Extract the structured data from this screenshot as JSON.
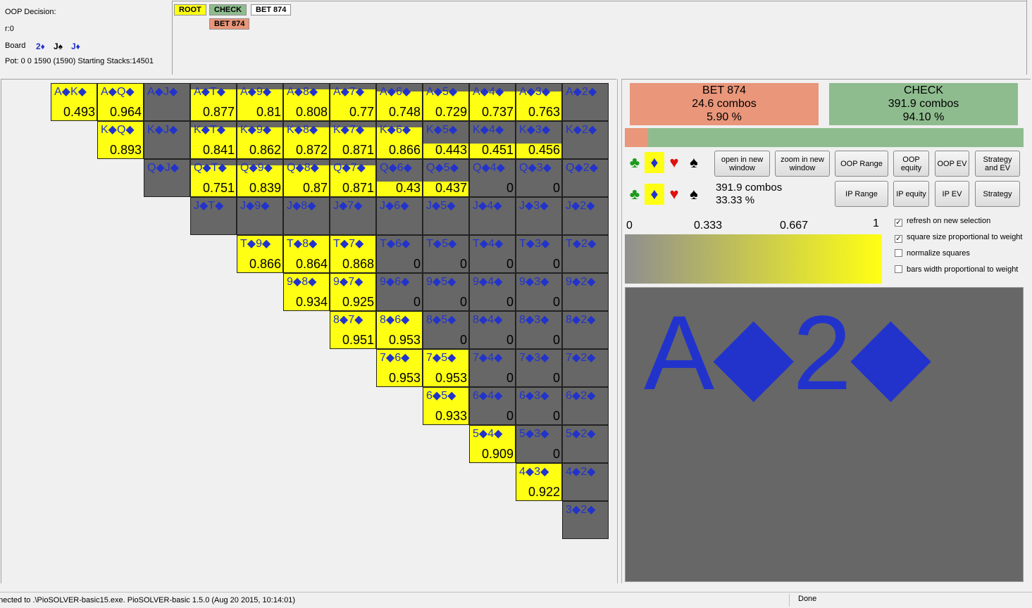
{
  "info": {
    "decision": "OOP Decision:",
    "r": "r:0",
    "board_label": "Board",
    "board_cards": [
      "2♦",
      "J♠",
      "J♦"
    ],
    "pot": "Pot: 0 0 1590 (1590) Starting Stacks:14501"
  },
  "tree": {
    "root": "ROOT",
    "check": "CHECK",
    "bet": "BET 874",
    "bet_child": "BET 874",
    "colors": {
      "root": "#ffff14",
      "check": "#8fbc8f",
      "bet_selected": "#ffffff",
      "bet": "#e9967a"
    }
  },
  "grid": {
    "rows": [
      {
        "row": 0,
        "cells": [
          {
            "label": "A◆K◆",
            "value": "0.493",
            "fill": 1
          },
          {
            "label": "A◆Q◆",
            "value": "0.964",
            "fill": 1
          },
          {
            "label": "A◆J◆",
            "value": "",
            "fill": 0
          },
          {
            "label": "A◆T◆",
            "value": "0.877",
            "fill": 0.85
          },
          {
            "label": "A◆9◆",
            "value": "0.81",
            "fill": 0.85
          },
          {
            "label": "A◆8◆",
            "value": "0.808",
            "fill": 0.85
          },
          {
            "label": "A◆7◆",
            "value": "0.77",
            "fill": 0.85
          },
          {
            "label": "A◆6◆",
            "value": "0.748",
            "fill": 0.78
          },
          {
            "label": "A◆5◆",
            "value": "0.729",
            "fill": 0.78
          },
          {
            "label": "A◆4◆",
            "value": "0.737",
            "fill": 0.78
          },
          {
            "label": "A◆3◆",
            "value": "0.763",
            "fill": 0.78
          },
          {
            "label": "A◆2◆",
            "value": "",
            "fill": 0
          }
        ]
      },
      {
        "row": 1,
        "cells": [
          {
            "label": "K◆Q◆",
            "value": "0.893",
            "fill": 1
          },
          {
            "label": "K◆J◆",
            "value": "",
            "fill": 0
          },
          {
            "label": "K◆T◆",
            "value": "0.841",
            "fill": 0.85
          },
          {
            "label": "K◆9◆",
            "value": "0.862",
            "fill": 0.85
          },
          {
            "label": "K◆8◆",
            "value": "0.872",
            "fill": 0.85
          },
          {
            "label": "K◆7◆",
            "value": "0.871",
            "fill": 0.85
          },
          {
            "label": "K◆6◆",
            "value": "0.866",
            "fill": 0.85
          },
          {
            "label": "K◆5◆",
            "value": "0.443",
            "fill": 0.4
          },
          {
            "label": "K◆4◆",
            "value": "0.451",
            "fill": 0.4
          },
          {
            "label": "K◆3◆",
            "value": "0.456",
            "fill": 0.4
          },
          {
            "label": "K◆2◆",
            "value": "",
            "fill": 0
          }
        ]
      },
      {
        "row": 2,
        "cells": [
          {
            "label": "Q◆J◆",
            "value": "",
            "fill": 0
          },
          {
            "label": "Q◆T◆",
            "value": "0.751",
            "fill": 0.85
          },
          {
            "label": "Q◆9◆",
            "value": "0.839",
            "fill": 0.85
          },
          {
            "label": "Q◆8◆",
            "value": "0.87",
            "fill": 0.85
          },
          {
            "label": "Q◆7◆",
            "value": "0.871",
            "fill": 0.85
          },
          {
            "label": "Q◆6◆",
            "value": "0.43",
            "fill": 0.4
          },
          {
            "label": "Q◆5◆",
            "value": "0.437",
            "fill": 0.4
          },
          {
            "label": "Q◆4◆",
            "value": "0",
            "fill": 0
          },
          {
            "label": "Q◆3◆",
            "value": "0",
            "fill": 0
          },
          {
            "label": "Q◆2◆",
            "value": "",
            "fill": 0
          }
        ]
      },
      {
        "row": 3,
        "cells": [
          {
            "label": "J◆T◆",
            "value": "",
            "fill": 0
          },
          {
            "label": "J◆9◆",
            "value": "",
            "fill": 0
          },
          {
            "label": "J◆8◆",
            "value": "",
            "fill": 0
          },
          {
            "label": "J◆7◆",
            "value": "",
            "fill": 0
          },
          {
            "label": "J◆6◆",
            "value": "",
            "fill": 0
          },
          {
            "label": "J◆5◆",
            "value": "",
            "fill": 0
          },
          {
            "label": "J◆4◆",
            "value": "",
            "fill": 0
          },
          {
            "label": "J◆3◆",
            "value": "",
            "fill": 0
          },
          {
            "label": "J◆2◆",
            "value": "",
            "fill": 0
          }
        ]
      },
      {
        "row": 4,
        "cells": [
          {
            "label": "T◆9◆",
            "value": "0.866",
            "fill": 1
          },
          {
            "label": "T◆8◆",
            "value": "0.864",
            "fill": 1
          },
          {
            "label": "T◆7◆",
            "value": "0.868",
            "fill": 1
          },
          {
            "label": "T◆6◆",
            "value": "0",
            "fill": 0
          },
          {
            "label": "T◆5◆",
            "value": "0",
            "fill": 0
          },
          {
            "label": "T◆4◆",
            "value": "0",
            "fill": 0
          },
          {
            "label": "T◆3◆",
            "value": "0",
            "fill": 0
          },
          {
            "label": "T◆2◆",
            "value": "",
            "fill": 0
          }
        ]
      },
      {
        "row": 5,
        "cells": [
          {
            "label": "9◆8◆",
            "value": "0.934",
            "fill": 1
          },
          {
            "label": "9◆7◆",
            "value": "0.925",
            "fill": 1
          },
          {
            "label": "9◆6◆",
            "value": "0",
            "fill": 0
          },
          {
            "label": "9◆5◆",
            "value": "0",
            "fill": 0
          },
          {
            "label": "9◆4◆",
            "value": "0",
            "fill": 0
          },
          {
            "label": "9◆3◆",
            "value": "0",
            "fill": 0
          },
          {
            "label": "9◆2◆",
            "value": "",
            "fill": 0
          }
        ]
      },
      {
        "row": 6,
        "cells": [
          {
            "label": "8◆7◆",
            "value": "0.951",
            "fill": 1
          },
          {
            "label": "8◆6◆",
            "value": "0.953",
            "fill": 1
          },
          {
            "label": "8◆5◆",
            "value": "0",
            "fill": 0
          },
          {
            "label": "8◆4◆",
            "value": "0",
            "fill": 0
          },
          {
            "label": "8◆3◆",
            "value": "0",
            "fill": 0
          },
          {
            "label": "8◆2◆",
            "value": "",
            "fill": 0
          }
        ]
      },
      {
        "row": 7,
        "cells": [
          {
            "label": "7◆6◆",
            "value": "0.953",
            "fill": 1
          },
          {
            "label": "7◆5◆",
            "value": "0.953",
            "fill": 1
          },
          {
            "label": "7◆4◆",
            "value": "0",
            "fill": 0
          },
          {
            "label": "7◆3◆",
            "value": "0",
            "fill": 0
          },
          {
            "label": "7◆2◆",
            "value": "",
            "fill": 0
          }
        ]
      },
      {
        "row": 8,
        "cells": [
          {
            "label": "6◆5◆",
            "value": "0.933",
            "fill": 1
          },
          {
            "label": "6◆4◆",
            "value": "0",
            "fill": 0
          },
          {
            "label": "6◆3◆",
            "value": "0",
            "fill": 0
          },
          {
            "label": "6◆2◆",
            "value": "",
            "fill": 0
          }
        ]
      },
      {
        "row": 9,
        "cells": [
          {
            "label": "5◆4◆",
            "value": "0.909",
            "fill": 1
          },
          {
            "label": "5◆3◆",
            "value": "0",
            "fill": 0
          },
          {
            "label": "5◆2◆",
            "value": "",
            "fill": 0
          }
        ]
      },
      {
        "row": 10,
        "cells": [
          {
            "label": "4◆3◆",
            "value": "0.922",
            "fill": 1
          },
          {
            "label": "4◆2◆",
            "value": "",
            "fill": 0
          }
        ]
      },
      {
        "row": 11,
        "cells": [
          {
            "label": "3◆2◆",
            "value": "",
            "fill": 0
          }
        ]
      }
    ]
  },
  "right": {
    "bet": {
      "title": "BET 874",
      "combos": "24.6 combos",
      "pct": "5.90 %"
    },
    "check": {
      "title": "CHECK",
      "combos": "391.9 combos",
      "pct": "94.10 %"
    },
    "bet_fraction": 0.059,
    "suits_row1": [
      "♣",
      "♦",
      "♥",
      "♠"
    ],
    "suits_row2": [
      "♣",
      "♦",
      "♥",
      "♠"
    ],
    "combos": "391.9 combos",
    "combos_pct": "33.33 %",
    "buttons": {
      "open_new": "open in new window",
      "zoom_new": "zoom in new window",
      "oop_range": "OOP Range",
      "oop_equity": "OOP equity",
      "oop_ev": "OOP EV",
      "strategy_ev": "Strategy and EV",
      "ip_range": "IP  Range",
      "ip_equity": "IP equity",
      "ip_ev": "IP  EV",
      "strategy": "Strategy"
    },
    "scale": [
      "0",
      "0.333",
      "0.667",
      "1"
    ],
    "checkboxes": [
      {
        "label": "refresh on new selection",
        "checked": true
      },
      {
        "label": "square size proportional to weight",
        "checked": true
      },
      {
        "label": "normalize squares",
        "checked": false
      },
      {
        "label": "bars width proportional to weight",
        "checked": false
      }
    ],
    "big_hand": "A◆2◆"
  },
  "status": {
    "left": "nnected to .\\PioSOLVER-basic15.exe. PioSOLVER-basic 1.5.0 (Aug 20 2015, 10:14:01)",
    "right": "Done"
  }
}
